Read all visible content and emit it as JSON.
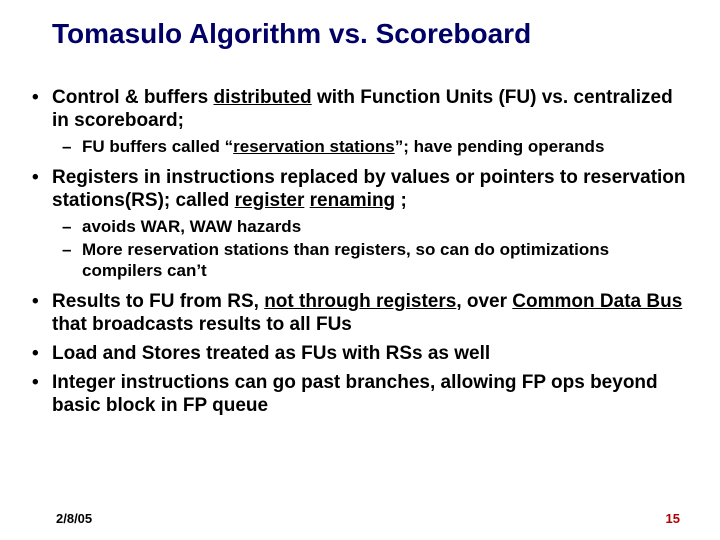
{
  "title": "Tomasulo Algorithm vs. Scoreboard",
  "b1a": "Control & buffers ",
  "b1b": "distributed",
  "b1c": " with Function Units (FU) vs. centralized in scoreboard;",
  "b1s1a": "FU buffers called “",
  "b1s1b": "reservation stations",
  "b1s1c": "”; have pending operands",
  "b2a": "Registers in instructions replaced by values or pointers to reservation stations(RS); called  ",
  "b2b": "register",
  "b2sp": " ",
  "b2c": "renaming",
  "b2d": " ;",
  "b2s1": "avoids WAR, WAW hazards",
  "b2s2": "More reservation stations than registers, so can do optimizations compilers can’t",
  "b3a": "Results to FU from RS, ",
  "b3b": "not through registers",
  "b3c": ", over ",
  "b3d": "Common Data Bus ",
  "b3e": "that broadcasts results to all FUs",
  "b4": "Load and Stores treated as FUs with RSs as well",
  "b5": "Integer instructions can go past branches, allowing FP ops beyond basic block in FP queue",
  "date": "2/8/05",
  "page": "15"
}
